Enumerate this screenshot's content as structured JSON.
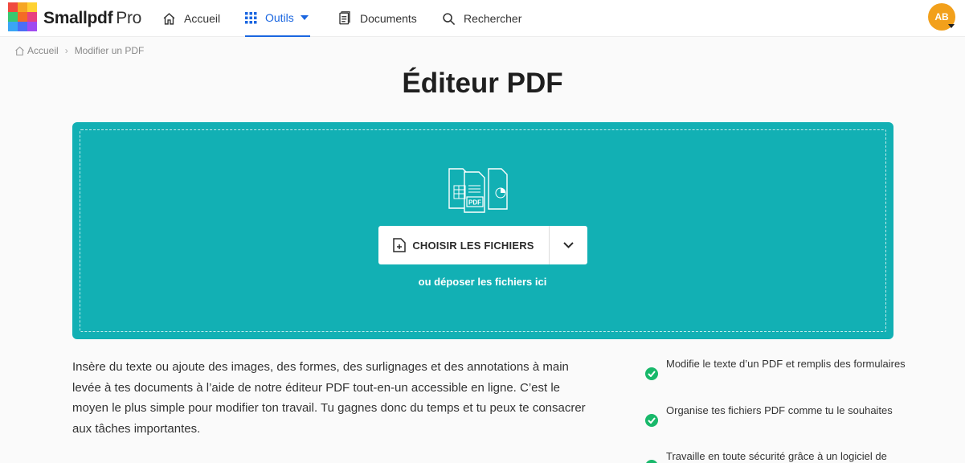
{
  "brand": {
    "name": "Smallpdf",
    "tier": "Pro"
  },
  "nav": {
    "home": "Accueil",
    "tools": "Outils",
    "documents": "Documents",
    "search": "Rechercher"
  },
  "user": {
    "initials": "AB"
  },
  "breadcrumb": {
    "home": "Accueil",
    "current": "Modifier un PDF"
  },
  "page": {
    "title": "Éditeur PDF"
  },
  "upload": {
    "choose_label": "CHOISIR LES FICHIERS",
    "drop_hint": "ou déposer les fichiers ici",
    "illustration_badge": "PDF"
  },
  "description": "Insère du texte ou ajoute des images, des formes, des surlignages et des annotations à main levée à tes documents à l’aide de notre éditeur PDF tout-en-un accessible en ligne. C’est le moyen le plus simple pour modifier ton travail. Tu gagnes donc du temps et tu peux te consacrer aux tâches importantes.",
  "features": [
    "Modifie le texte d’un PDF et remplis des formulaires",
    "Organise tes fichiers PDF comme tu le souhaites",
    "Travaille en toute sécurité grâce à un logiciel de"
  ],
  "colors": {
    "accent": "#1a66e0",
    "dropzone": "#12b0b4",
    "avatar": "#f2a01b",
    "check": "#18b86a"
  }
}
